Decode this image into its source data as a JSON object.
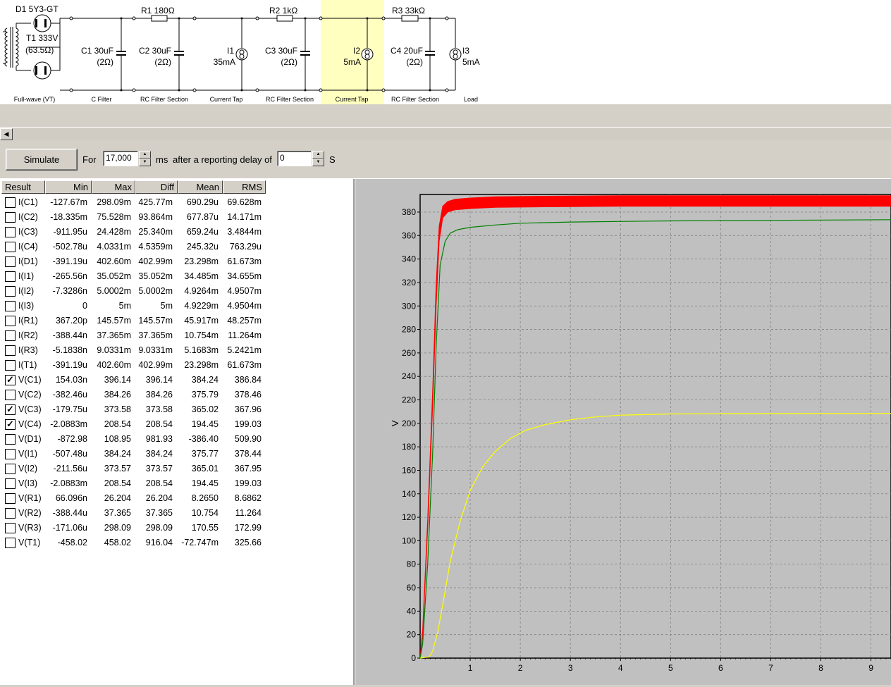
{
  "schematic": {
    "parts": {
      "d1": "D1 5Y3-GT",
      "t1_name": "T1 333V",
      "t1_r": "(63.5Ω)",
      "r1": "R1 180Ω",
      "r2": "R2 1kΩ",
      "r3": "R3 33kΩ",
      "c1_val": "C1 30uF",
      "c1_r": "(2Ω)",
      "c2_val": "C2 30uF",
      "c2_r": "(2Ω)",
      "i1_name": "I1",
      "i1_val": "35mA",
      "c3_val": "C3 30uF",
      "c3_r": "(2Ω)",
      "i2_name": "I2",
      "i2_val": "5mA",
      "c4_val": "C4 20uF",
      "c4_r": "(2Ω)",
      "i3_name": "I3",
      "i3_val": "5mA"
    },
    "sections": [
      "Full-wave (VT)",
      "C Filter",
      "RC Filter Section",
      "Current Tap",
      "RC Filter Section",
      "Current Tap",
      "RC Filter Section",
      "Load"
    ],
    "highlight_color": "#ffffc0"
  },
  "toolbar": {
    "simulate_label": "Simulate",
    "for_label": "For",
    "duration_value": "17,000",
    "ms_label": "ms",
    "delay_label": "after a reporting delay of",
    "delay_value": "0",
    "s_label": "S"
  },
  "results": {
    "columns": [
      "Result",
      "Min",
      "Max",
      "Diff",
      "Mean",
      "RMS"
    ],
    "rows": [
      {
        "name": "I(C1)",
        "min": "-127.67m",
        "max": "298.09m",
        "diff": "425.77m",
        "mean": "690.29u",
        "rms": "69.628m",
        "checked": false
      },
      {
        "name": "I(C2)",
        "min": "-18.335m",
        "max": "75.528m",
        "diff": "93.864m",
        "mean": "677.87u",
        "rms": "14.171m",
        "checked": false
      },
      {
        "name": "I(C3)",
        "min": "-911.95u",
        "max": "24.428m",
        "diff": "25.340m",
        "mean": "659.24u",
        "rms": "3.4844m",
        "checked": false
      },
      {
        "name": "I(C4)",
        "min": "-502.78u",
        "max": "4.0331m",
        "diff": "4.5359m",
        "mean": "245.32u",
        "rms": "763.29u",
        "checked": false
      },
      {
        "name": "I(D1)",
        "min": "-391.19u",
        "max": "402.60m",
        "diff": "402.99m",
        "mean": "23.298m",
        "rms": "61.673m",
        "checked": false
      },
      {
        "name": "I(I1)",
        "min": "-265.56n",
        "max": "35.052m",
        "diff": "35.052m",
        "mean": "34.485m",
        "rms": "34.655m",
        "checked": false
      },
      {
        "name": "I(I2)",
        "min": "-7.3286n",
        "max": "5.0002m",
        "diff": "5.0002m",
        "mean": "4.9264m",
        "rms": "4.9507m",
        "checked": false
      },
      {
        "name": "I(I3)",
        "min": "0",
        "max": "5m",
        "diff": "5m",
        "mean": "4.9229m",
        "rms": "4.9504m",
        "checked": false
      },
      {
        "name": "I(R1)",
        "min": "367.20p",
        "max": "145.57m",
        "diff": "145.57m",
        "mean": "45.917m",
        "rms": "48.257m",
        "checked": false
      },
      {
        "name": "I(R2)",
        "min": "-388.44n",
        "max": "37.365m",
        "diff": "37.365m",
        "mean": "10.754m",
        "rms": "11.264m",
        "checked": false
      },
      {
        "name": "I(R3)",
        "min": "-5.1838n",
        "max": "9.0331m",
        "diff": "9.0331m",
        "mean": "5.1683m",
        "rms": "5.2421m",
        "checked": false
      },
      {
        "name": "I(T1)",
        "min": "-391.19u",
        "max": "402.60m",
        "diff": "402.99m",
        "mean": "23.298m",
        "rms": "61.673m",
        "checked": false
      },
      {
        "name": "V(C1)",
        "min": "154.03n",
        "max": "396.14",
        "diff": "396.14",
        "mean": "384.24",
        "rms": "386.84",
        "checked": true
      },
      {
        "name": "V(C2)",
        "min": "-382.46u",
        "max": "384.26",
        "diff": "384.26",
        "mean": "375.79",
        "rms": "378.46",
        "checked": false
      },
      {
        "name": "V(C3)",
        "min": "-179.75u",
        "max": "373.58",
        "diff": "373.58",
        "mean": "365.02",
        "rms": "367.96",
        "checked": true
      },
      {
        "name": "V(C4)",
        "min": "-2.0883m",
        "max": "208.54",
        "diff": "208.54",
        "mean": "194.45",
        "rms": "199.03",
        "checked": true
      },
      {
        "name": "V(D1)",
        "min": "-872.98",
        "max": "108.95",
        "diff": "981.93",
        "mean": "-386.40",
        "rms": "509.90",
        "checked": false
      },
      {
        "name": "V(I1)",
        "min": "-507.48u",
        "max": "384.24",
        "diff": "384.24",
        "mean": "375.77",
        "rms": "378.44",
        "checked": false
      },
      {
        "name": "V(I2)",
        "min": "-211.56u",
        "max": "373.57",
        "diff": "373.57",
        "mean": "365.01",
        "rms": "367.95",
        "checked": false
      },
      {
        "name": "V(I3)",
        "min": "-2.0883m",
        "max": "208.54",
        "diff": "208.54",
        "mean": "194.45",
        "rms": "199.03",
        "checked": false
      },
      {
        "name": "V(R1)",
        "min": "66.096n",
        "max": "26.204",
        "diff": "26.204",
        "mean": "8.2650",
        "rms": "8.6862",
        "checked": false
      },
      {
        "name": "V(R2)",
        "min": "-388.44u",
        "max": "37.365",
        "diff": "37.365",
        "mean": "10.754",
        "rms": "11.264",
        "checked": false
      },
      {
        "name": "V(R3)",
        "min": "-171.06u",
        "max": "298.09",
        "diff": "298.09",
        "mean": "170.55",
        "rms": "172.99",
        "checked": false
      },
      {
        "name": "V(T1)",
        "min": "-458.02",
        "max": "458.02",
        "diff": "916.04",
        "mean": "-72.747m",
        "rms": "325.66",
        "checked": false
      }
    ]
  },
  "chart_data": {
    "type": "line",
    "ylabel": "V",
    "xlabel": "",
    "xlim": [
      0,
      9.4
    ],
    "ylim": [
      0,
      395
    ],
    "xticks": [
      1,
      2,
      3,
      4,
      5,
      6,
      7,
      8,
      9
    ],
    "yticks": [
      0,
      20,
      40,
      60,
      80,
      100,
      120,
      140,
      160,
      180,
      200,
      220,
      240,
      260,
      280,
      300,
      320,
      340,
      360,
      380
    ],
    "grid": true,
    "background": "#c0c0c0",
    "series": [
      {
        "color": "#ff0000",
        "band": true,
        "x": [
          0,
          0.05,
          0.15,
          0.25,
          0.32,
          0.38,
          0.45,
          0.55,
          0.7,
          1.0,
          1.5,
          2.5,
          4,
          6,
          9.4
        ],
        "lo": [
          0,
          20,
          110,
          215,
          300,
          355,
          375,
          380,
          382,
          383,
          384,
          384.5,
          385,
          385,
          385
        ],
        "hi": [
          0,
          24,
          118,
          228,
          318,
          368,
          385,
          389,
          391,
          392,
          393,
          393.5,
          394,
          394,
          394
        ]
      },
      {
        "color": "#008000",
        "x": [
          0,
          0.05,
          0.15,
          0.25,
          0.32,
          0.4,
          0.5,
          0.6,
          0.75,
          1.0,
          1.5,
          2.0,
          3.0,
          5.0,
          9.4
        ],
        "y": [
          0,
          12,
          80,
          175,
          265,
          335,
          355,
          362,
          365,
          367,
          369,
          370.5,
          371.5,
          372.5,
          373.5
        ]
      },
      {
        "color": "#ffff00",
        "x": [
          0,
          0.18,
          0.25,
          0.35,
          0.45,
          0.6,
          0.8,
          1.0,
          1.25,
          1.5,
          1.8,
          2.1,
          2.5,
          3.0,
          3.5,
          4.0,
          5.0,
          6.0,
          9.4
        ],
        "y": [
          0,
          1,
          6,
          22,
          45,
          82,
          117,
          143,
          163,
          176,
          187,
          194,
          199,
          203,
          205.5,
          207,
          208,
          208.3,
          208.5
        ]
      }
    ]
  }
}
